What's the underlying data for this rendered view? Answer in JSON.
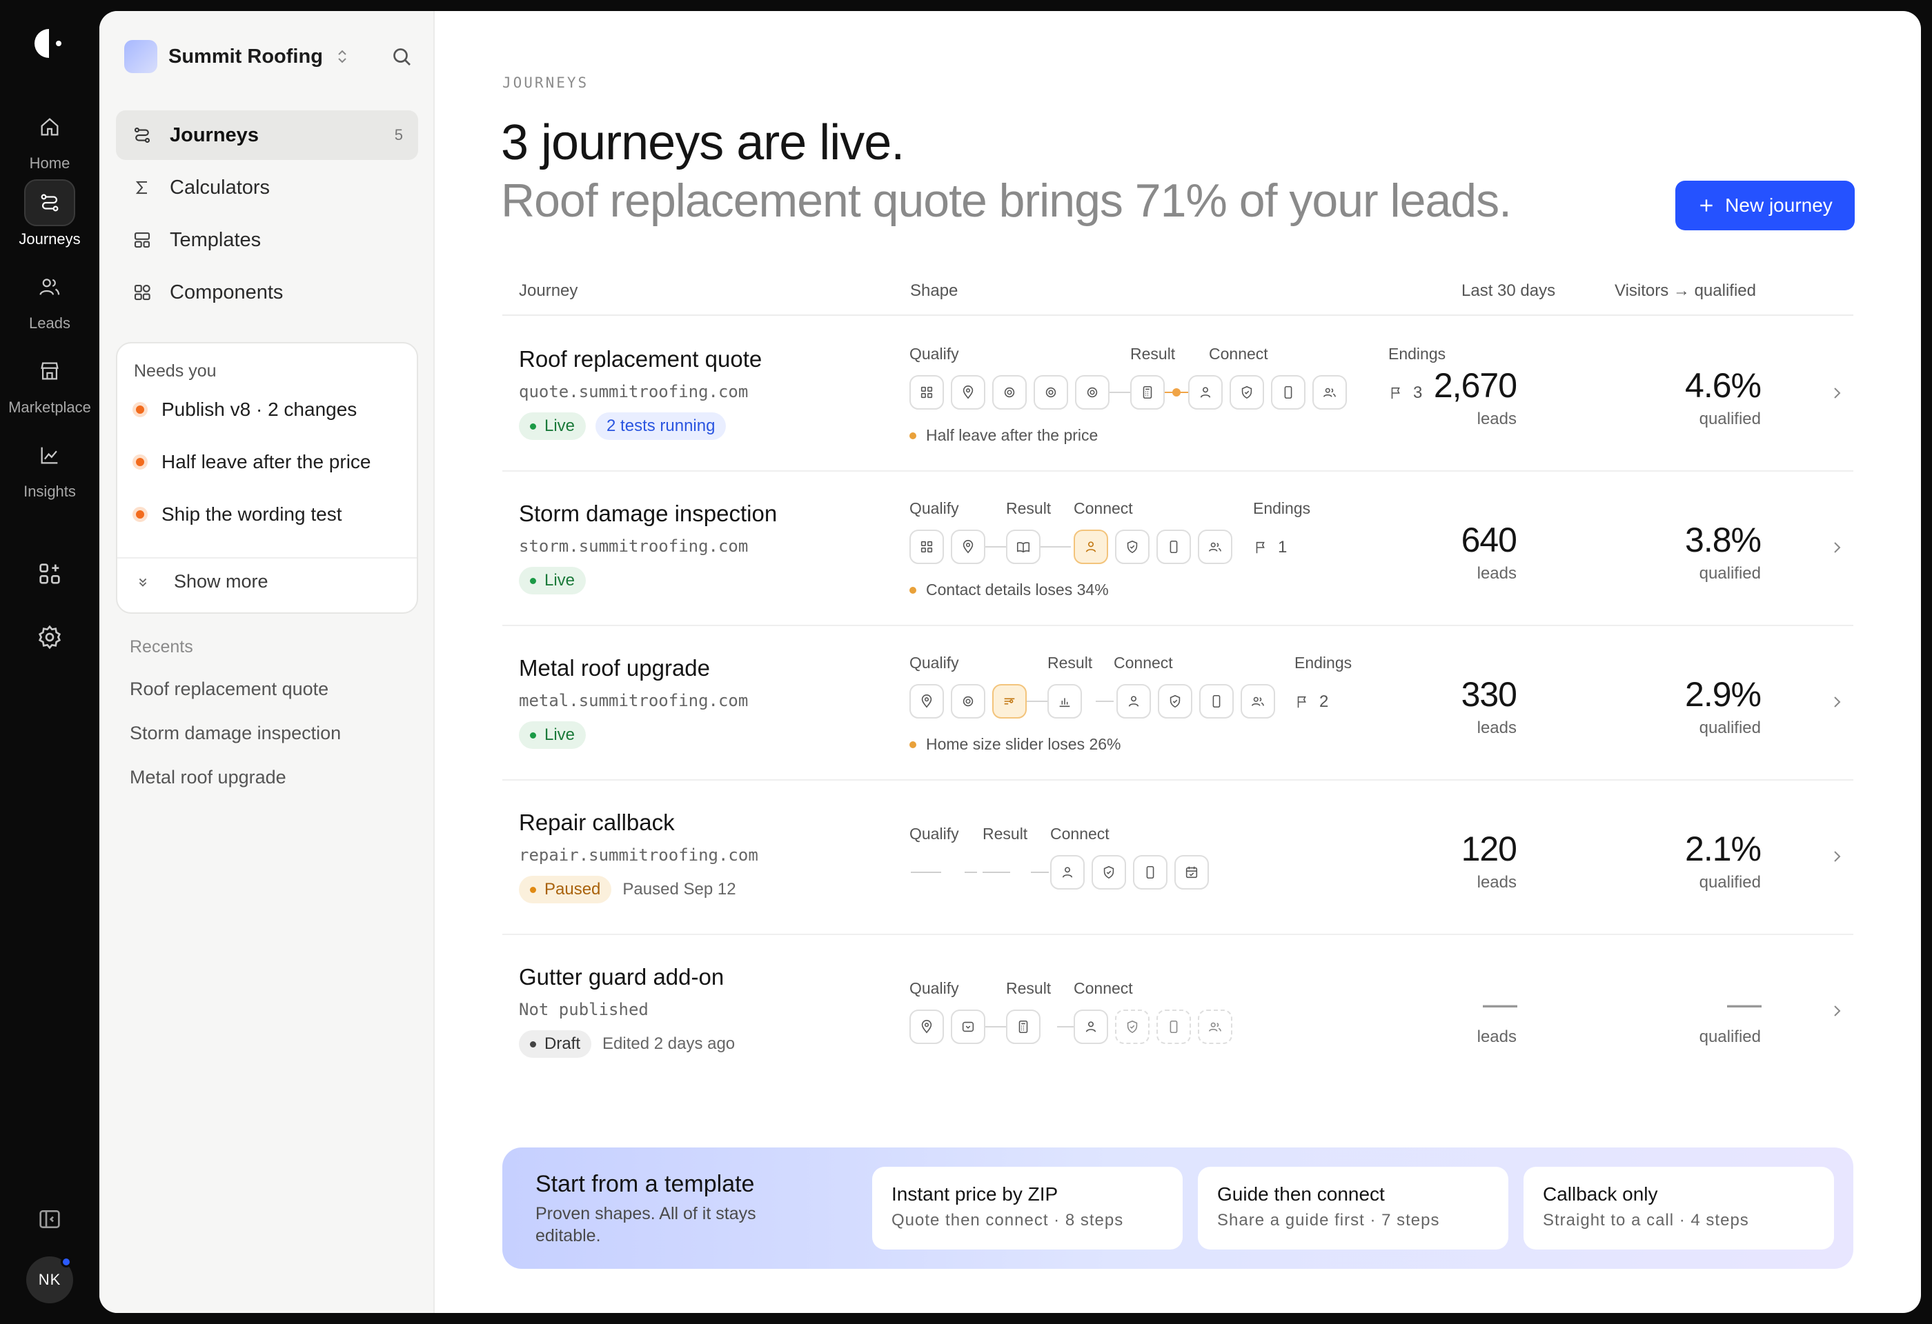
{
  "rail": {
    "items": [
      {
        "label": "Home",
        "icon": "home-icon"
      },
      {
        "label": "Journeys",
        "icon": "journeys-icon",
        "active": true
      },
      {
        "label": "Leads",
        "icon": "leads-icon"
      },
      {
        "label": "Marketplace",
        "icon": "store-icon"
      },
      {
        "label": "Insights",
        "icon": "chart-icon"
      }
    ],
    "avatar": "NK"
  },
  "sidebar": {
    "workspace": "Summit Roofing",
    "nav": [
      {
        "label": "Journeys",
        "count": "5",
        "active": true
      },
      {
        "label": "Calculators"
      },
      {
        "label": "Templates"
      },
      {
        "label": "Components"
      }
    ],
    "needs_title": "Needs you",
    "needs": [
      "Publish v8 · 2 changes",
      "Half leave after the price",
      "Ship the wording test"
    ],
    "show_more": "Show more",
    "recents_title": "Recents",
    "recents": [
      "Roof replacement quote",
      "Storm damage inspection",
      "Metal roof upgrade"
    ]
  },
  "header": {
    "eyebrow": "JOURNEYS",
    "headline": "3 journeys are live.",
    "subline": "Roof replacement quote brings 71% of your leads.",
    "new_button": "New journey"
  },
  "table": {
    "columns": [
      "Journey",
      "Shape",
      "Last 30 days",
      "Visitors → qualified"
    ],
    "rows": [
      {
        "name": "Roof replacement quote",
        "domain": "quote.summitroofing.com",
        "status": "Live",
        "extra": "2 tests running",
        "note": "",
        "labels": {
          "qualify": "Qualify",
          "result": "Result",
          "connect": "Connect",
          "endings": "Endings"
        },
        "endings": "3",
        "hint": "Half leave after the price",
        "leads": "2,670",
        "leads_label": "leads",
        "rate": "4.6%",
        "rate_label": "qualified"
      },
      {
        "name": "Storm damage inspection",
        "domain": "storm.summitroofing.com",
        "status": "Live",
        "note": "",
        "labels": {
          "qualify": "Qualify",
          "result": "Result",
          "connect": "Connect",
          "endings": "Endings"
        },
        "endings": "1",
        "hint": "Contact details loses 34%",
        "leads": "640",
        "leads_label": "leads",
        "rate": "3.8%",
        "rate_label": "qualified"
      },
      {
        "name": "Metal roof upgrade",
        "domain": "metal.summitroofing.com",
        "status": "Live",
        "note": "",
        "labels": {
          "qualify": "Qualify",
          "result": "Result",
          "connect": "Connect",
          "endings": "Endings"
        },
        "endings": "2",
        "hint": "Home size slider loses 26%",
        "leads": "330",
        "leads_label": "leads",
        "rate": "2.9%",
        "rate_label": "qualified"
      },
      {
        "name": "Repair callback",
        "domain": "repair.summitroofing.com",
        "status": "Paused",
        "note": "Paused Sep 12",
        "labels": {
          "qualify": "Qualify",
          "result": "Result",
          "connect": "Connect"
        },
        "leads": "120",
        "leads_label": "leads",
        "rate": "2.1%",
        "rate_label": "qualified"
      },
      {
        "name": "Gutter guard add-on",
        "domain": "Not published",
        "status": "Draft",
        "note": "Edited 2 days ago",
        "labels": {
          "qualify": "Qualify",
          "result": "Result",
          "connect": "Connect"
        },
        "leads": "—",
        "leads_label": "leads",
        "rate": "—",
        "rate_label": "qualified"
      }
    ]
  },
  "templates": {
    "title": "Start from a template",
    "subtitle": "Proven shapes. All of it stays editable.",
    "cards": [
      {
        "title": "Instant price by ZIP",
        "sub": "Quote then connect · 8 steps"
      },
      {
        "title": "Guide then connect",
        "sub": "Share a guide first · 7 steps"
      },
      {
        "title": "Callback only",
        "sub": "Straight to a call · 4 steps"
      }
    ]
  },
  "colors": {
    "accent": "#2552ff",
    "live": "#1b9a46",
    "warning": "#f26b1d",
    "paused": "#e08a14"
  }
}
